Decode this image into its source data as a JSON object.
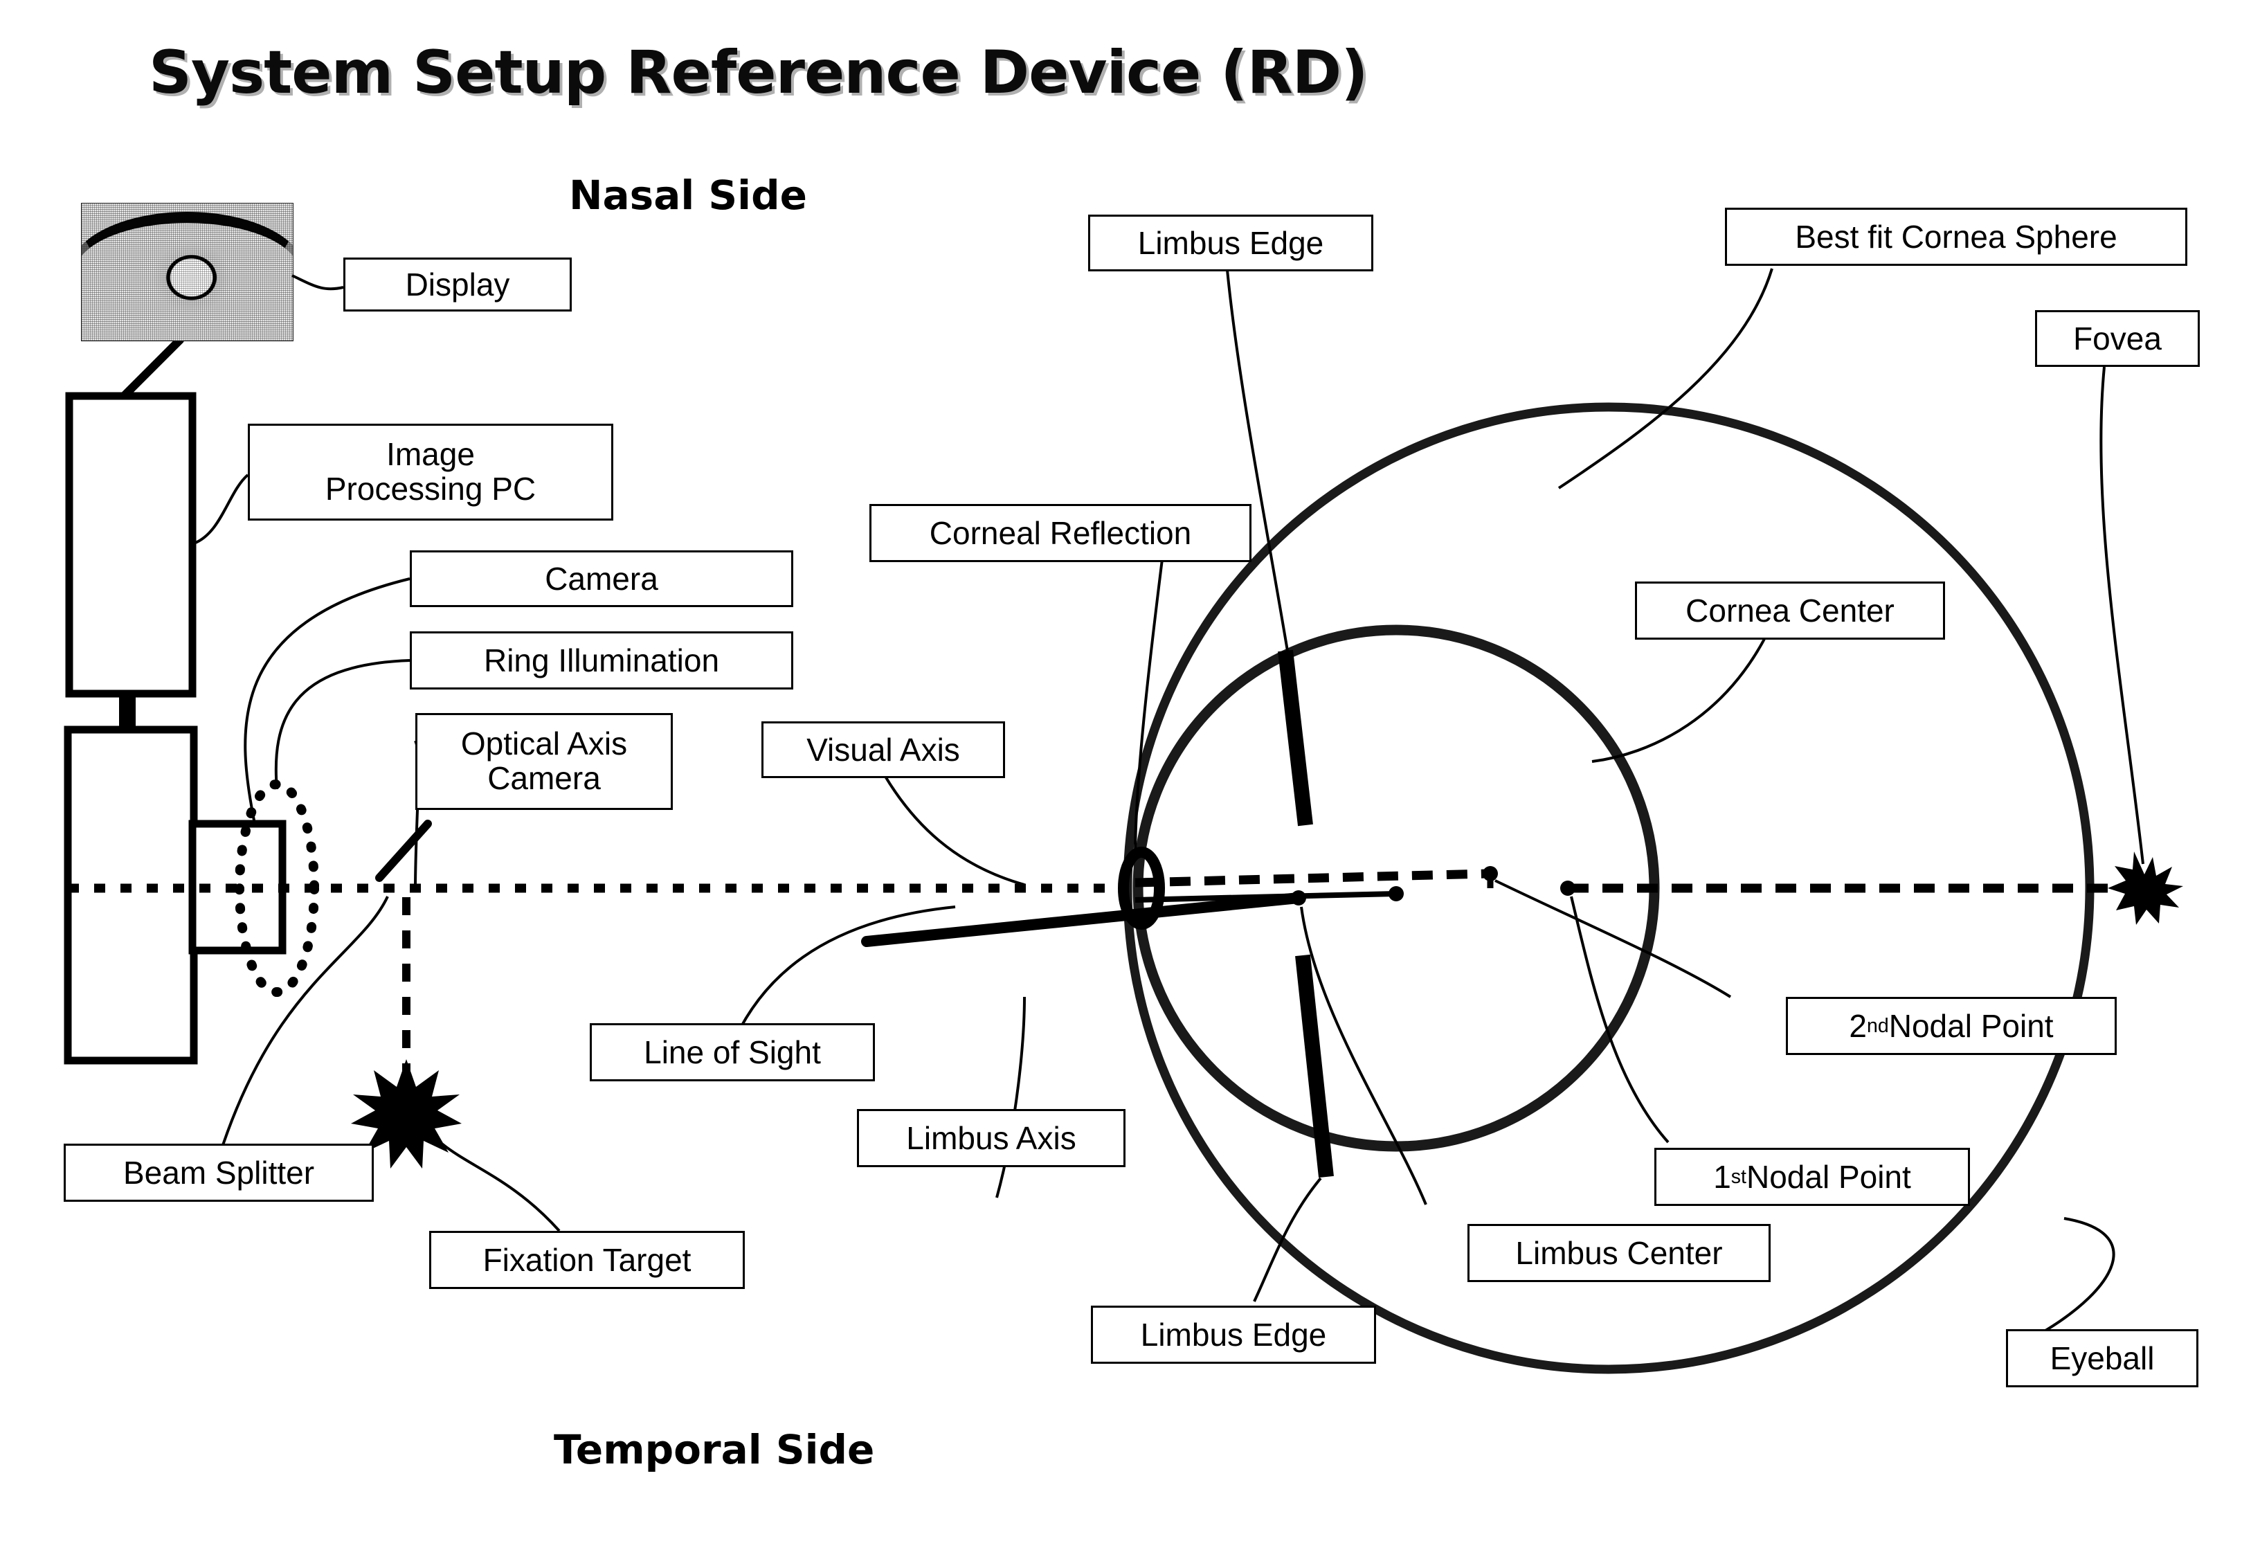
{
  "title": "System Setup Reference Device (RD)",
  "orientation": {
    "nasal": "Nasal Side",
    "temporal": "Temporal Side"
  },
  "labels": {
    "display": "Display",
    "image_processing_pc_line1": "Image",
    "image_processing_pc_line2": "Processing PC",
    "camera": "Camera",
    "ring_illumination": "Ring Illumination",
    "optical_axis_camera_line1": "Optical Axis",
    "optical_axis_camera_line2": "Camera",
    "beam_splitter": "Beam Splitter",
    "fixation_target": "Fixation Target",
    "visual_axis": "Visual Axis",
    "line_of_sight": "Line of Sight",
    "limbus_axis": "Limbus Axis",
    "limbus_edge_top": "Limbus Edge",
    "limbus_edge_bottom": "Limbus Edge",
    "corneal_reflection": "Corneal Reflection",
    "best_fit_cornea_sphere": "Best fit Cornea Sphere",
    "fovea": "Fovea",
    "cornea_center": "Cornea Center",
    "second_nodal_point_number": "2",
    "second_nodal_point_ordinal": "nd",
    "second_nodal_point_rest": " Nodal Point",
    "first_nodal_point_number": "1",
    "first_nodal_point_ordinal": "st",
    "first_nodal_point_rest": " Nodal Point",
    "limbus_center": "Limbus Center",
    "eyeball": "Eyeball"
  },
  "colors": {
    "ink": "#000000",
    "paper": "#ffffff",
    "title_shadow": "#505050"
  }
}
